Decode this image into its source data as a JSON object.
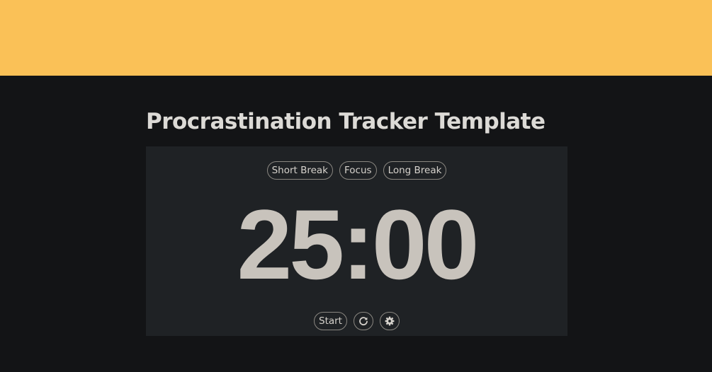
{
  "page": {
    "title": "Procrastination Tracker Template",
    "banner_color": "#fac157",
    "background_color": "#131416"
  },
  "timer": {
    "modes": [
      "Short Break",
      "Focus",
      "Long Break"
    ],
    "display": "25:00",
    "start_label": "Start",
    "reset_icon": "reset-icon",
    "settings_icon": "gear-icon",
    "text_color": "#c8c3bc",
    "card_color": "#1f2225"
  }
}
